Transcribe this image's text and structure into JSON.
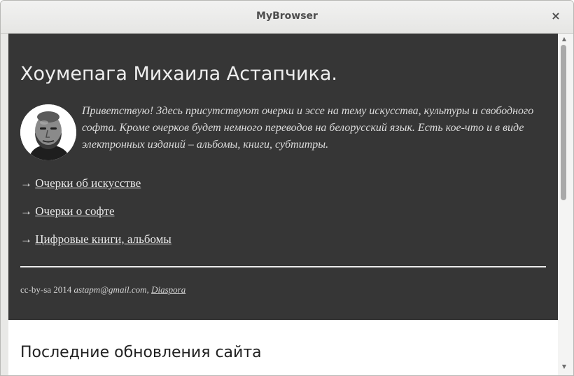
{
  "window": {
    "title": "MyBrowser",
    "close_glyph": "×"
  },
  "page": {
    "heading": "Хоумепага Михаила Астапчика.",
    "intro": "Приветствую! Здесь присутствуют очерки и эссе на тему искусства, культуры и свободного софта. Кроме очерков будет немного переводов на белорусский язык. Есть кое-что и в виде электронных изданий – альбомы, книги, субтитры.",
    "links": [
      {
        "arrow": "→",
        "label": "Очерки об искусстве"
      },
      {
        "arrow": "→",
        "label": "Очерки о софте"
      },
      {
        "arrow": "→",
        "label": "Цифровые книги, альбомы"
      }
    ],
    "footer": {
      "license": "cc-by-sa 2014",
      "email": "astapm@gmail.com,",
      "diaspora_label": "Diaspora"
    },
    "section_heading": "Последние обновления сайта"
  },
  "scrollbar": {
    "up_glyph": "▲",
    "down_glyph": "▼"
  },
  "colors": {
    "hero_background": "#363636",
    "page_background": "#ffffff",
    "titlebar": "#e9e9e7"
  }
}
